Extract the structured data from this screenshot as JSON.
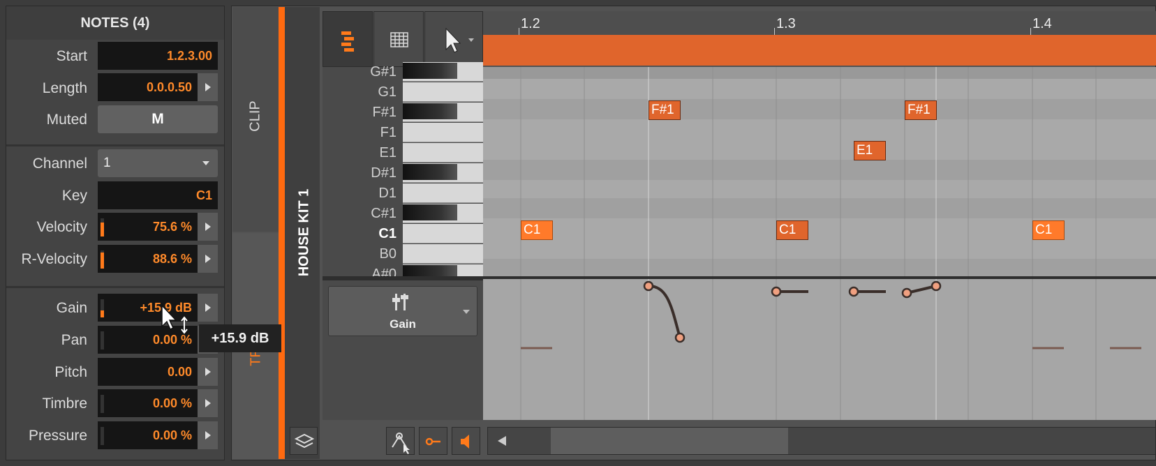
{
  "inspector": {
    "title": "NOTES (4)",
    "fields": [
      {
        "label": "Start",
        "value": "1.2.3.00"
      },
      {
        "label": "Length",
        "value": "0.0.0.50"
      },
      {
        "label": "Muted",
        "value": "M"
      },
      {
        "label": "Channel",
        "value": "1"
      },
      {
        "label": "Key",
        "value": "C1"
      },
      {
        "label": "Velocity",
        "value": "75.6 %",
        "level": 0.756
      },
      {
        "label": "R-Velocity",
        "value": "88.6 %",
        "level": 0.886
      },
      {
        "label": "Gain",
        "value": "+15.9 dB",
        "level": 0.4
      },
      {
        "label": "Pan",
        "value": "0.00 %"
      },
      {
        "label": "Pitch",
        "value": "0.00"
      },
      {
        "label": "Timbre",
        "value": "0.00 %"
      },
      {
        "label": "Pressure",
        "value": "0.00 %"
      }
    ]
  },
  "tooltip": "+15.9 dB",
  "side_tabs": {
    "clip": "CLIP",
    "track": "TR",
    "kit": "HOUSE KIT 1"
  },
  "timeline": {
    "markers": [
      "1.2",
      "1.3",
      "1.4"
    ]
  },
  "piano_keys": [
    {
      "label": "G#1",
      "black": true
    },
    {
      "label": "G1",
      "black": false
    },
    {
      "label": "F#1",
      "black": true
    },
    {
      "label": "F1",
      "black": false
    },
    {
      "label": "E1",
      "black": false
    },
    {
      "label": "D#1",
      "black": true
    },
    {
      "label": "D1",
      "black": false
    },
    {
      "label": "C#1",
      "black": true
    },
    {
      "label": "C1",
      "black": false,
      "selected": true
    },
    {
      "label": "B0",
      "black": false
    },
    {
      "label": "A#0",
      "black": true
    }
  ],
  "notes": [
    {
      "label": "C1",
      "selected": true
    },
    {
      "label": "F#1",
      "selected": false
    },
    {
      "label": "C1",
      "selected": false
    },
    {
      "label": "E1",
      "selected": false
    },
    {
      "label": "F#1",
      "selected": false
    },
    {
      "label": "C1",
      "selected": true
    }
  ],
  "automation": {
    "param_label": "Gain"
  },
  "colors": {
    "accent": "#ff7a1a",
    "clip_bar": "#e0652c"
  },
  "icons": [
    "piano-roll-icon",
    "grid-icon",
    "pointer-tool-icon",
    "layers-icon",
    "envelope-tool-icon",
    "key-tool-icon",
    "speaker-icon",
    "scroll-left-icon"
  ]
}
